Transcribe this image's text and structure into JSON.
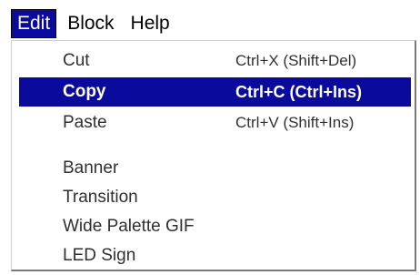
{
  "menubar": {
    "items": [
      {
        "label": "Edit",
        "active": true
      },
      {
        "label": "Block",
        "active": false
      },
      {
        "label": "Help",
        "active": false
      }
    ]
  },
  "menu": {
    "items": [
      {
        "label": "Cut",
        "shortcut": "Ctrl+X (Shift+Del)",
        "selected": false
      },
      {
        "label": "Copy",
        "shortcut": "Ctrl+C (Ctrl+Ins)",
        "selected": true
      },
      {
        "label": "Paste",
        "shortcut": "Ctrl+V (Shift+Ins)",
        "selected": false
      },
      {
        "label": "Banner",
        "shortcut": "",
        "selected": false
      },
      {
        "label": "Transition",
        "shortcut": "",
        "selected": false
      },
      {
        "label": "Wide Palette GIF",
        "shortcut": "",
        "selected": false
      },
      {
        "label": "LED Sign",
        "shortcut": "",
        "selected": false
      }
    ]
  },
  "colors": {
    "selection_bg": "#0a0a9c",
    "selection_fg": "#ffffff",
    "menu_bg": "#ffffff"
  }
}
